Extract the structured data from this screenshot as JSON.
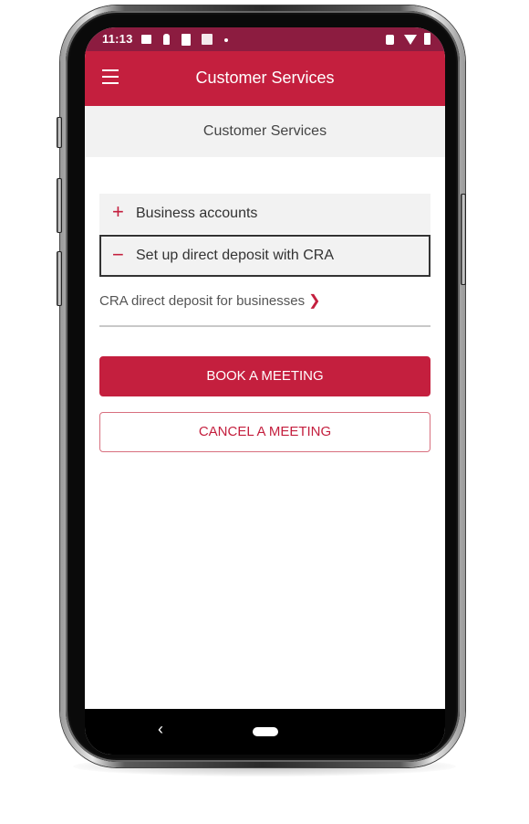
{
  "status_bar": {
    "time": "11:13",
    "left_icons": [
      "image-icon",
      "keyhole-icon",
      "sim-card-icon",
      "cibc-app-icon",
      "notification-dot-icon"
    ],
    "right_icons": [
      "vibrate-icon",
      "wifi-icon",
      "battery-icon"
    ]
  },
  "app_bar": {
    "menu_icon": "hamburger-menu-icon",
    "title": "Customer Services"
  },
  "subheader": {
    "title": "Customer Services"
  },
  "accordion": [
    {
      "label": "Business accounts",
      "sign": "+",
      "expanded": false
    },
    {
      "label": "Set up direct deposit with CRA",
      "sign": "−",
      "expanded": true
    }
  ],
  "links": [
    {
      "label": "CRA direct deposit for businesses",
      "chevron": "❯"
    }
  ],
  "buttons": {
    "book": "BOOK A MEETING",
    "cancel": "CANCEL A MEETING"
  },
  "nav_bar": {
    "back": "‹"
  },
  "colors": {
    "brand_red": "#c41f3e",
    "status_bar": "#8c1c40",
    "subheader_bg": "#f2f2f2"
  }
}
